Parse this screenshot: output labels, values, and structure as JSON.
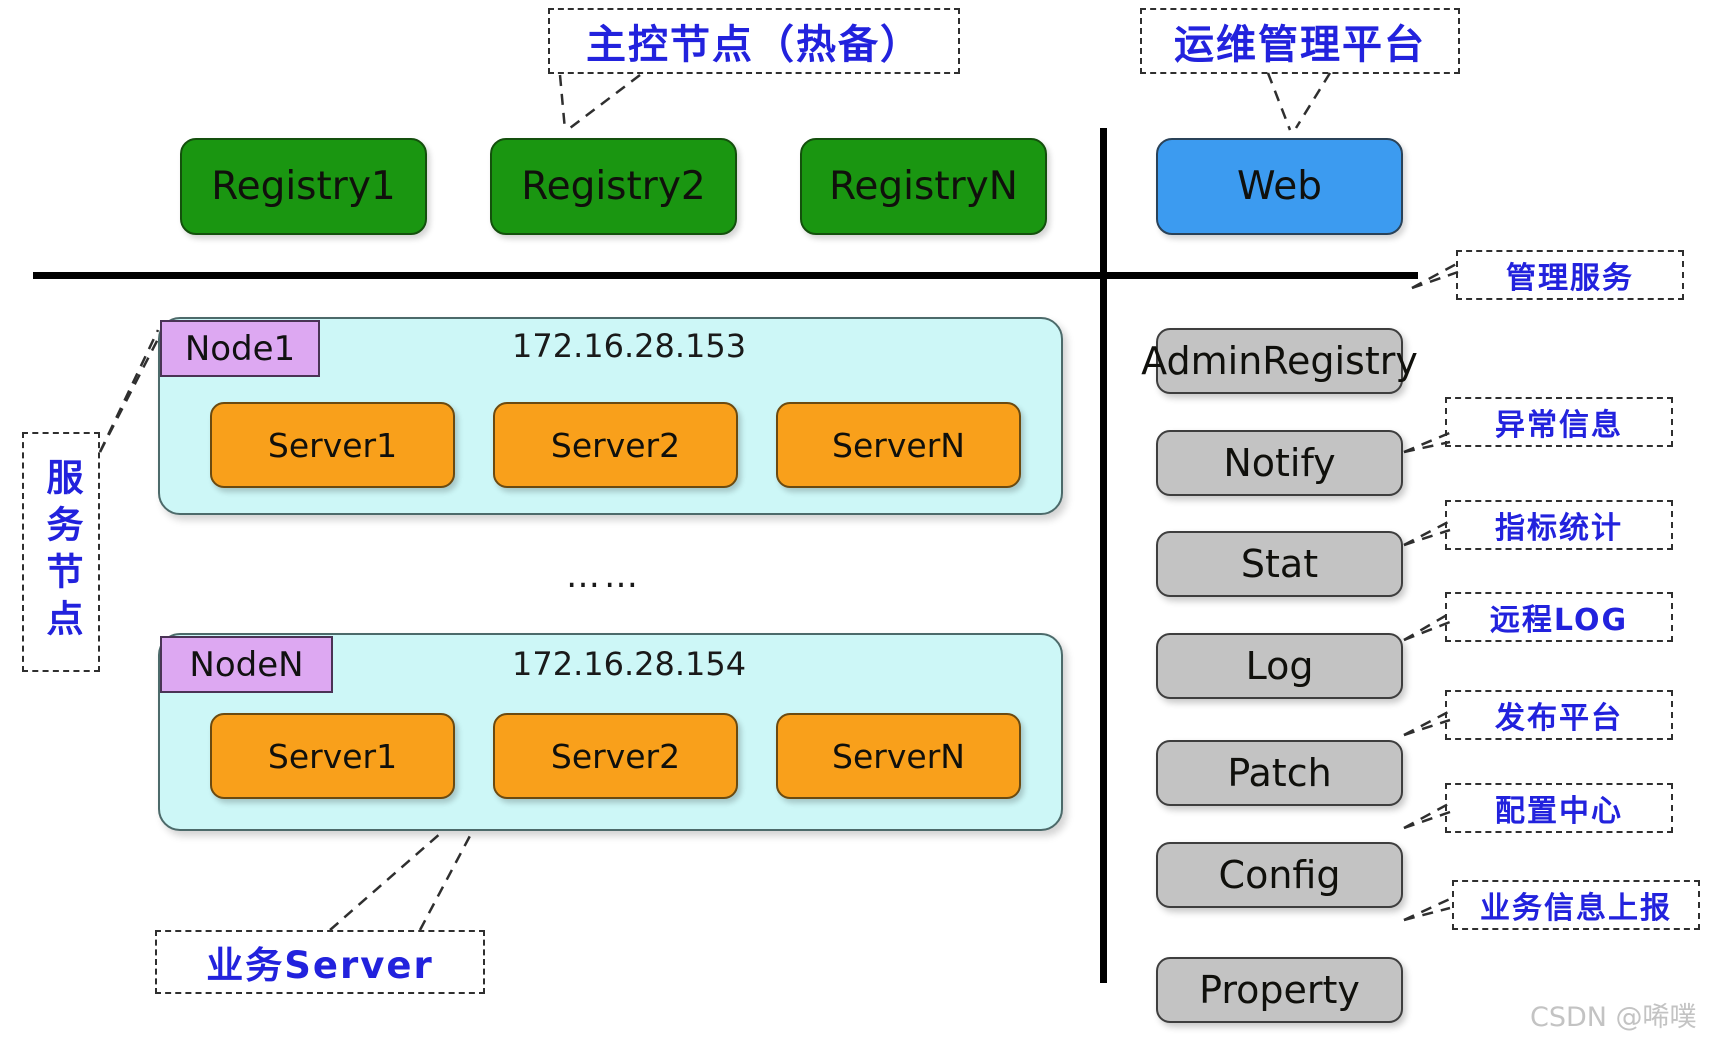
{
  "diagram": {
    "title_annotations": {
      "master_node": "主控节点（热备）",
      "ops_platform": "运维管理平台",
      "service_node": "服务节点",
      "business_server": "业务Server"
    },
    "registry_row": {
      "boxes": [
        {
          "label": "Registry1"
        },
        {
          "label": "Registry2"
        },
        {
          "label": "RegistryN"
        }
      ]
    },
    "web": {
      "label": "Web"
    },
    "nodes": [
      {
        "tag": "Node1",
        "ip": "172.16.28.153",
        "servers": [
          {
            "label": "Server1"
          },
          {
            "label": "Server2"
          },
          {
            "label": "ServerN"
          }
        ]
      },
      {
        "tag": "NodeN",
        "ip": "172.16.28.154",
        "servers": [
          {
            "label": "Server1"
          },
          {
            "label": "Server2"
          },
          {
            "label": "ServerN"
          }
        ]
      }
    ],
    "node_separator": "……",
    "services": [
      {
        "label": "AdminRegistry",
        "annotation": "管理服务"
      },
      {
        "label": "Notify",
        "annotation": "异常信息"
      },
      {
        "label": "Stat",
        "annotation": "指标统计"
      },
      {
        "label": "Log",
        "annotation": "远程LOG"
      },
      {
        "label": "Patch",
        "annotation": "发布平台"
      },
      {
        "label": "Config",
        "annotation": "配置中心"
      },
      {
        "label": "Property",
        "annotation": "业务信息上报"
      }
    ],
    "watermark": "CSDN @唏噗",
    "colors": {
      "registry_green": "#1a9611",
      "web_blue": "#3c9bf0",
      "service_gray": "#c3c3c3",
      "server_orange": "#f9a01b",
      "node_cyan": "#cdf7f7",
      "node_tag_purple": "#dda8f2",
      "annotation_blue": "#2222dd",
      "rule_black": "#000000"
    }
  }
}
